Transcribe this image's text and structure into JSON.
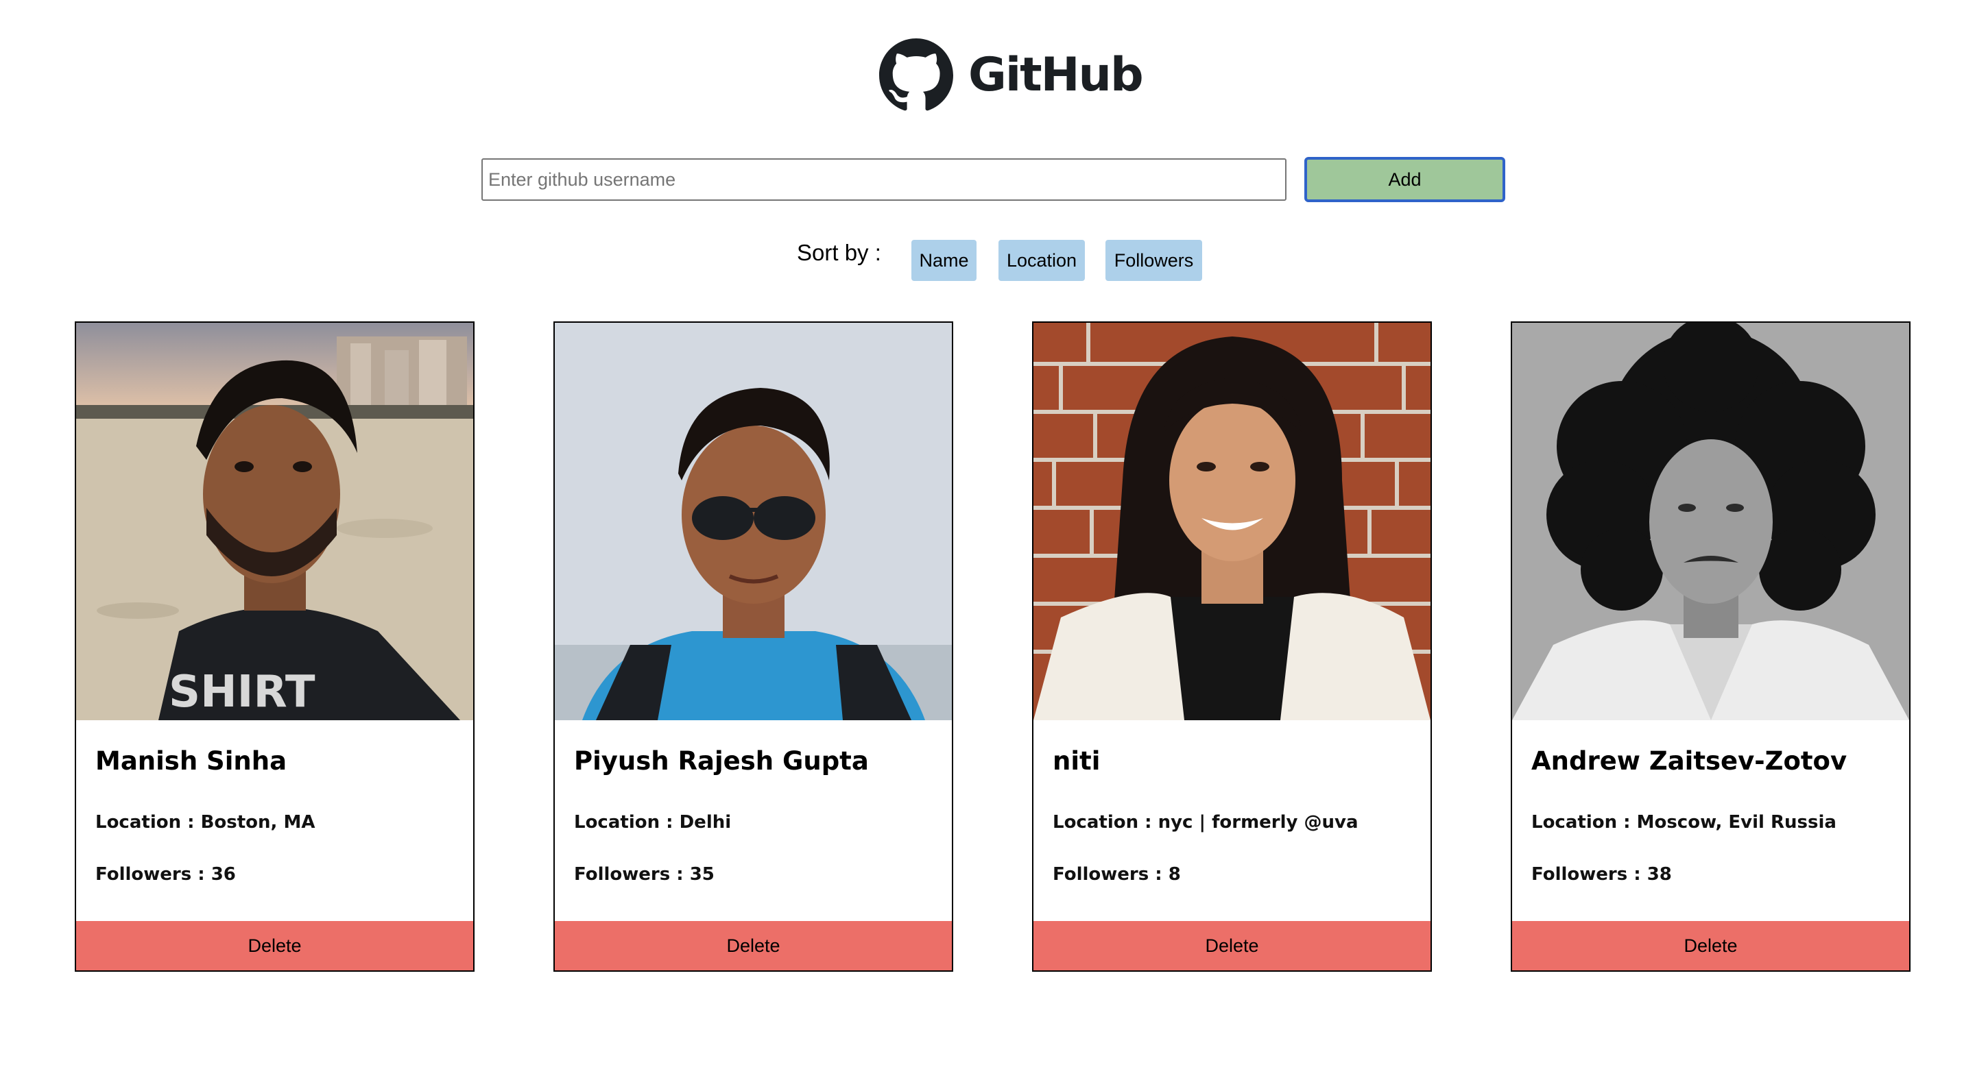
{
  "header": {
    "logo_text": "GitHub"
  },
  "search": {
    "placeholder": "Enter github username",
    "value": "",
    "add_label": "Add"
  },
  "sort": {
    "label": "Sort by :",
    "options": [
      "Name",
      "Location",
      "Followers"
    ]
  },
  "colors": {
    "add_button": "#9fc79a",
    "add_button_border": "#2f63c9",
    "sort_button": "#add0ea",
    "delete_button": "#ec6f68"
  },
  "cards": [
    {
      "name": "Manish Sinha",
      "location": "Location : Boston, MA",
      "followers": "Followers : 36",
      "delete_label": "Delete"
    },
    {
      "name": "Piyush Rajesh Gupta",
      "location": "Location : Delhi",
      "followers": "Followers : 35",
      "delete_label": "Delete"
    },
    {
      "name": "niti",
      "location": "Location : nyc | formerly @uva",
      "followers": "Followers : 8",
      "delete_label": "Delete"
    },
    {
      "name": "Andrew Zaitsev-Zotov",
      "location": "Location : Moscow, Evil Russia",
      "followers": "Followers : 38",
      "delete_label": "Delete"
    }
  ]
}
